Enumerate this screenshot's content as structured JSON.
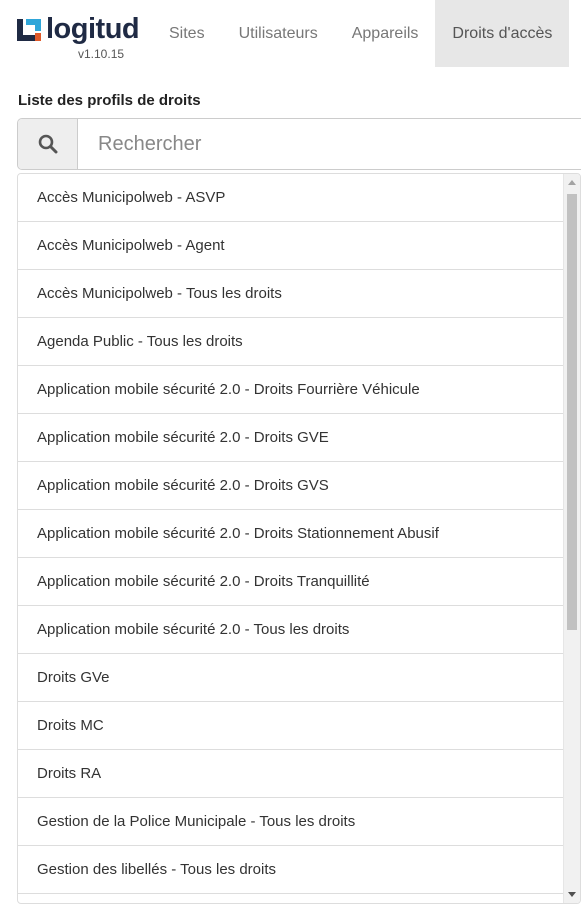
{
  "app": {
    "logo_text": "logitud",
    "version": "v1.10.15",
    "brand_colors": {
      "mark_primary": "#1f2a44",
      "mark_accent": "#2fa6d9",
      "mark_warm": "#e05a2a"
    }
  },
  "nav": {
    "items": [
      {
        "label": "Sites",
        "active": false
      },
      {
        "label": "Utilisateurs",
        "active": false
      },
      {
        "label": "Appareils",
        "active": false
      },
      {
        "label": "Droits d'accès",
        "active": true
      }
    ]
  },
  "section": {
    "title": "Liste des profils de droits"
  },
  "search": {
    "placeholder": "Rechercher",
    "value": "",
    "icon": "search-icon"
  },
  "profiles": [
    "Accès Municipolweb - ASVP",
    "Accès Municipolweb - Agent",
    "Accès Municipolweb - Tous les droits",
    "Agenda Public - Tous les droits",
    "Application mobile sécurité 2.0 - Droits Fourrière Véhicule",
    "Application mobile sécurité 2.0 - Droits GVE",
    "Application mobile sécurité 2.0 - Droits GVS",
    "Application mobile sécurité 2.0 - Droits Stationnement Abusif",
    "Application mobile sécurité 2.0 - Droits Tranquillité",
    "Application mobile sécurité 2.0 - Tous les droits",
    "Droits GVe",
    "Droits MC",
    "Droits RA",
    "Gestion de la Police Municipale - Tous les droits",
    "Gestion des libellés - Tous les droits"
  ]
}
